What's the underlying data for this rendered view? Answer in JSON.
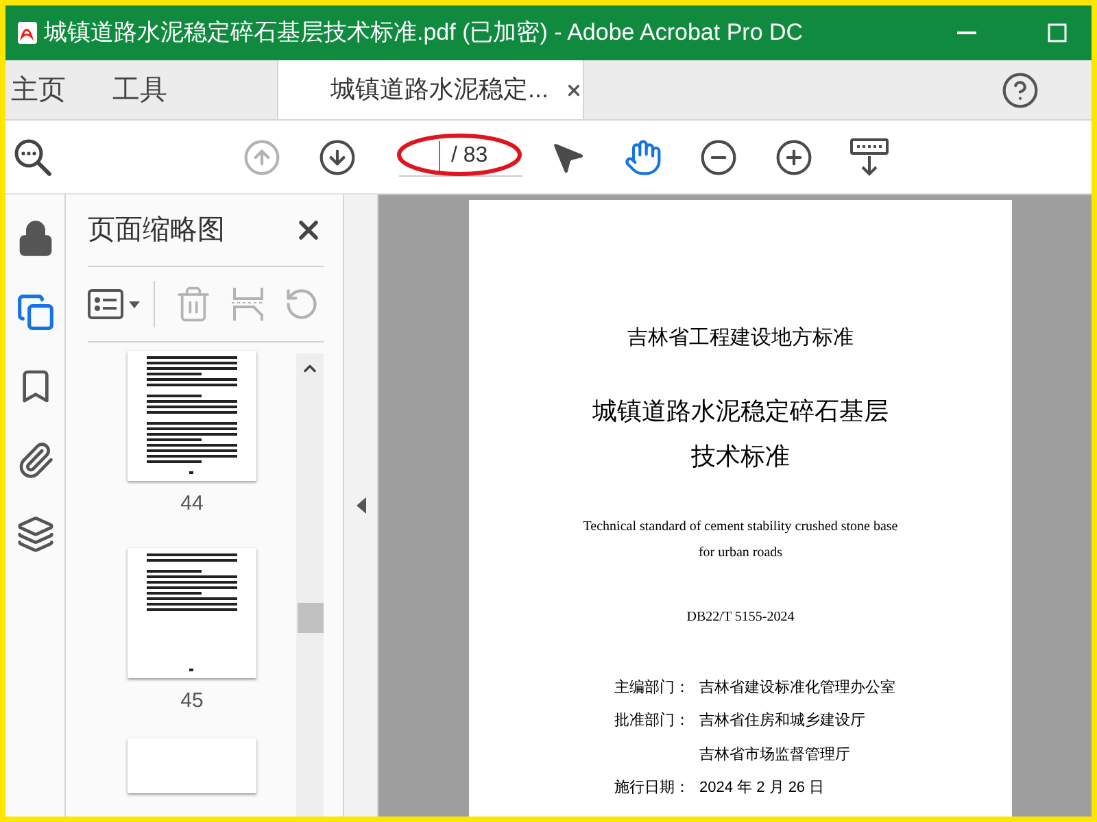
{
  "window": {
    "title": "城镇道路水泥稳定碎石基层技术标准.pdf  (已加密)  - Adobe Acrobat Pro DC"
  },
  "tabs": [
    {
      "label": "主页",
      "kind": "home",
      "selected": false
    },
    {
      "label": "工具",
      "kind": "home",
      "selected": false
    },
    {
      "label": "城镇道路水泥稳定...",
      "kind": "document",
      "selected": true
    }
  ],
  "toolbar": {
    "page_total": "/ 83",
    "tools": [
      {
        "kind": "page-up",
        "disabled": true,
        "selected": false
      },
      {
        "kind": "page-down",
        "disabled": false,
        "selected": false
      },
      {
        "kind": "select",
        "disabled": false,
        "selected": false
      },
      {
        "kind": "hand",
        "disabled": false,
        "selected": true
      },
      {
        "kind": "zoom-out",
        "disabled": false,
        "selected": false
      },
      {
        "kind": "zoom-in",
        "disabled": false,
        "selected": false
      },
      {
        "kind": "keyboard",
        "disabled": false,
        "selected": false
      }
    ]
  },
  "rail": [
    {
      "kind": "lock",
      "selected": false
    },
    {
      "kind": "pages",
      "selected": true
    },
    {
      "kind": "bookmark",
      "selected": false
    },
    {
      "kind": "attachment",
      "selected": false
    },
    {
      "kind": "layers",
      "selected": false
    }
  ],
  "thumbnails_panel": {
    "title": "页面缩略图",
    "actions": [
      {
        "kind": "options",
        "disabled": false
      },
      {
        "kind": "delete",
        "disabled": true
      },
      {
        "kind": "extract",
        "disabled": true
      },
      {
        "kind": "rotate",
        "disabled": true
      }
    ],
    "pages": [
      {
        "label": "44"
      },
      {
        "label": "45"
      }
    ]
  },
  "document": {
    "org": "吉林省工程建设地方标准",
    "title_lines": [
      "城镇道路水泥稳定碎石基层",
      "技术标准"
    ],
    "english_lines": [
      "Technical standard of cement stability crushed stone base",
      "for urban roads"
    ],
    "code": "DB22/T 5155-2024",
    "credits": [
      {
        "label": "主编部门：",
        "value": "吉林省建设标准化管理办公室"
      },
      {
        "label": "批准部门：",
        "value": "吉林省住房和城乡建设厅"
      },
      {
        "value": "吉林省市场监督管理厅"
      },
      {
        "label": "施行日期：",
        "value": "2024 年 2 月 26 日"
      }
    ]
  }
}
